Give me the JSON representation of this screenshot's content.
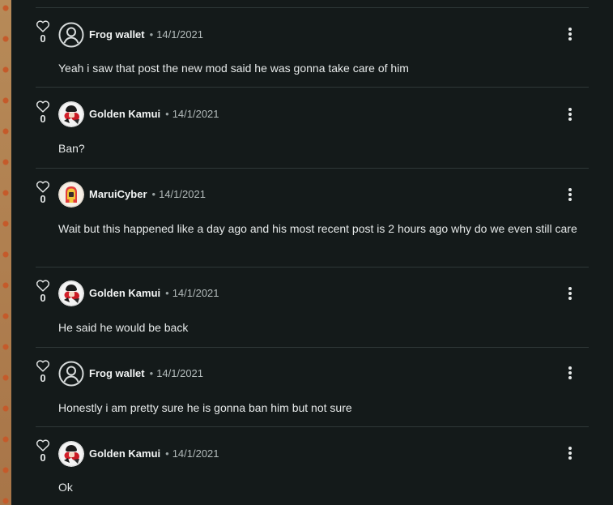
{
  "comments": [
    {
      "likes": "0",
      "username": "Frog wallet",
      "date": "14/1/2021",
      "text": "Yeah i saw that post the new mod said he was gonna take care of him",
      "avatar": "default-user-icon"
    },
    {
      "likes": "0",
      "username": "Golden Kamui",
      "date": "14/1/2021",
      "text": "Ban?",
      "avatar": "golden-kamui-avatar"
    },
    {
      "likes": "0",
      "username": "MaruiCyber",
      "date": "14/1/2021",
      "text": "Wait but this happened like a day ago and his most recent post is 2 hours ago why do we even still care",
      "avatar": "maruicyber-avatar"
    },
    {
      "likes": "0",
      "username": "Golden Kamui",
      "date": "14/1/2021",
      "text": "He said he would be back",
      "avatar": "golden-kamui-avatar"
    },
    {
      "likes": "0",
      "username": "Frog wallet",
      "date": "14/1/2021",
      "text": "Honestly i am pretty sure he is gonna ban him but not sure",
      "avatar": "default-user-icon"
    },
    {
      "likes": "0",
      "username": "Golden Kamui",
      "date": "14/1/2021",
      "text": "Ok",
      "avatar": "golden-kamui-avatar"
    }
  ],
  "separator": "•",
  "colors": {
    "panel_bg": "#141a1a",
    "divider": "#2f3838",
    "text": "#e6e9e9",
    "muted": "#b4bcbc"
  }
}
